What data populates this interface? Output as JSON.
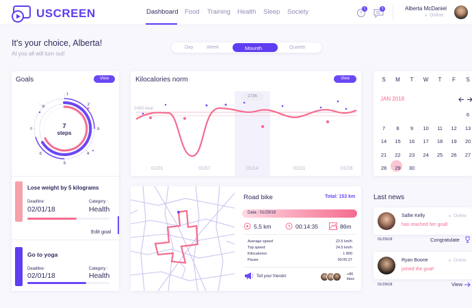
{
  "app": {
    "name": "USCREEN"
  },
  "nav": [
    "Dashboard",
    "Food",
    "Training",
    "Health",
    "Sleep",
    "Society"
  ],
  "header": {
    "notif_count": "1",
    "msg_count": "3",
    "user_name": "Alberta McDaniel",
    "user_status": "Online"
  },
  "greeting": {
    "title": "It's your choice, Alberta!",
    "subtitle": "At you all will turn out!"
  },
  "period_tabs": [
    "Day",
    "Week",
    "Mounth",
    "Quarter"
  ],
  "goals": {
    "title": "Goals",
    "view": "View",
    "ring_value": "7",
    "ring_unit": "steps",
    "ring_ticks": [
      "1",
      "2",
      "3",
      "4",
      "5",
      "6",
      "7",
      "8"
    ],
    "goal1": {
      "title": "Lose weight by 5 kilograms",
      "deadline_label": "Deadline:",
      "deadline": "02/01/18",
      "category_label": "Category :",
      "category": "Health",
      "action": "Edit goal"
    },
    "goal2": {
      "title": "Go to yoga",
      "deadline_label": "Deadline:",
      "deadline": "02/01/18",
      "category_label": "Category :",
      "category": "Health"
    }
  },
  "kcal": {
    "title": "Kilocalories norm",
    "view": "View",
    "norm_label": "2450 kkal",
    "tooltip": "2736",
    "dates": [
      "01/01",
      "01/07",
      "01/14",
      "01/21",
      "01/28"
    ]
  },
  "calendar": {
    "weekdays": [
      "S",
      "M",
      "T",
      "W",
      "T",
      "F",
      "S"
    ],
    "month": "JAN 2018",
    "rows": [
      [
        "",
        "",
        "",
        "",
        "",
        "",
        "6"
      ],
      [
        "7",
        "8",
        "9",
        "10",
        "11",
        "12",
        "13"
      ],
      [
        "14",
        "15",
        "16",
        "17",
        "18",
        "19",
        "20"
      ],
      [
        "21",
        "22",
        "23",
        "24",
        "25",
        "26",
        "27"
      ],
      [
        "28",
        "29",
        "30",
        "",
        "",
        "",
        ""
      ]
    ],
    "prev_icon": "arrow-left",
    "next_icon": "arrow-right"
  },
  "ride": {
    "title": "Road bike",
    "total": "Total: 153 km",
    "date": "Data : 01/29/18",
    "distance": "5,5 km",
    "time": "00:14:35",
    "height": "86m",
    "stats": [
      {
        "label": "Average speed",
        "value": "22.5 km/h"
      },
      {
        "label": "Top speed",
        "value": "24.5 km/h"
      },
      {
        "label": "Kilocalories",
        "value": "1 800"
      },
      {
        "label": "Pause",
        "value": "00:05:27"
      }
    ],
    "share": "Tell your friends!",
    "likes_count": "+86",
    "likes_label": "likes"
  },
  "news": {
    "title": "Last news",
    "items": [
      {
        "name": "Sallie Kelly",
        "status": "Online",
        "text": "has reached her goal!",
        "date": "01/29/18",
        "action": "Congratulate"
      },
      {
        "name": "Ryan Boone",
        "status": "Online",
        "text": "joined the goal!",
        "date": "01/29/18",
        "action": "View"
      }
    ]
  },
  "colors": {
    "accent": "#6b47f5",
    "pink": "#f56b8f",
    "text": "#2d2b5c"
  }
}
